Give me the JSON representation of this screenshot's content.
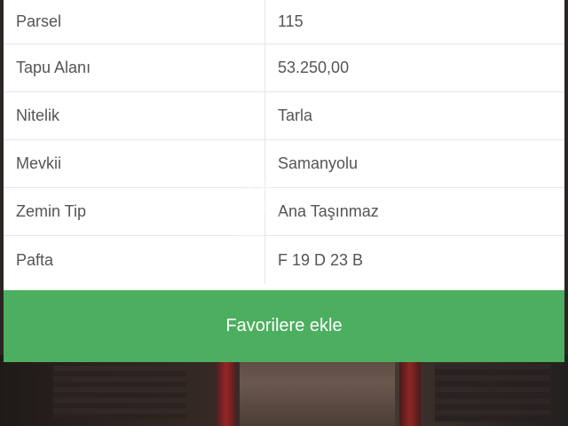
{
  "details": {
    "rows": [
      {
        "label": "Parsel",
        "value": "115"
      },
      {
        "label": "Tapu Alanı",
        "value": "53.250,00"
      },
      {
        "label": "Nitelik",
        "value": "Tarla"
      },
      {
        "label": "Mevkii",
        "value": "Samanyolu"
      },
      {
        "label": "Zemin Tip",
        "value": "Ana Taşınmaz"
      },
      {
        "label": "Pafta",
        "value": "F 19 D 23 B"
      }
    ]
  },
  "actions": {
    "favorite_label": "Favorilere ekle",
    "favorite_color": "#4caf5f"
  }
}
